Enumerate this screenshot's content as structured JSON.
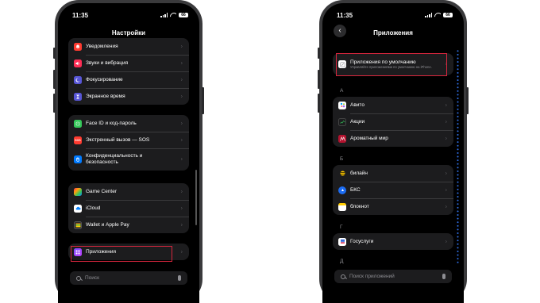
{
  "left_phone": {
    "status": {
      "time": "11:35",
      "battery": "66"
    },
    "title": "Настройки",
    "group1": [
      {
        "label": "Уведомления",
        "icon": "bell-icon",
        "color": "#ff3b30"
      },
      {
        "label": "Звуки и вибрация",
        "icon": "speaker-icon",
        "color": "#ff2d55"
      },
      {
        "label": "Фокусирование",
        "icon": "moon-icon",
        "color": "#5856d6"
      },
      {
        "label": "Экранное время",
        "icon": "hourglass-icon",
        "color": "#5856d6"
      }
    ],
    "group2": [
      {
        "label": "Face ID и код-пароль",
        "icon": "face-id-icon",
        "color": "#34c759"
      },
      {
        "label": "Экстренный вызов — SOS",
        "icon": "sos-icon",
        "color": "#ff3b30",
        "glyph": "SOS"
      },
      {
        "label": "Конфиденциальность и безопасность",
        "icon": "hand-icon",
        "color": "#007aff"
      }
    ],
    "group3": [
      {
        "label": "Game Center",
        "icon": "game-center-icon",
        "color": "#ff9f0a"
      },
      {
        "label": "iCloud",
        "icon": "cloud-icon",
        "color": "#0a84ff"
      },
      {
        "label": "Wallet и Apple Pay",
        "icon": "wallet-icon",
        "color": "#2c2c2e"
      }
    ],
    "group4": [
      {
        "label": "Приложения",
        "icon": "apps-icon",
        "color": "#7d4dff"
      }
    ],
    "search_placeholder": "Поиск"
  },
  "right_phone": {
    "status": {
      "time": "11:35",
      "battery": "66"
    },
    "title": "Приложения",
    "default_apps": {
      "label": "Приложения по умолчанию",
      "sublabel": "Управляйте приложениями по умолчанию на iPhone.",
      "icon": "default-apps-icon"
    },
    "sections": [
      {
        "letter": "А",
        "apps": [
          {
            "label": "Авито",
            "icon": "avito-icon",
            "color": "#00aaff"
          },
          {
            "label": "Акции",
            "icon": "stocks-icon",
            "color": "#1c1c1e"
          },
          {
            "label": "Ароматный мир",
            "icon": "aromatny-mir-icon",
            "color": "#b3122e"
          }
        ]
      },
      {
        "letter": "Б",
        "apps": [
          {
            "label": "билайн",
            "icon": "beeline-icon",
            "color": "#1c1c1e"
          },
          {
            "label": "БКС",
            "icon": "bks-icon",
            "color": "#1c6cf2"
          },
          {
            "label": "блокнот",
            "icon": "notepad-icon",
            "color": "#ffcc00"
          }
        ]
      },
      {
        "letter": "Г",
        "apps": [
          {
            "label": "Госуслуги",
            "icon": "gosuslugi-icon",
            "color": "#ffffff"
          }
        ]
      },
      {
        "letter": "Д",
        "apps": []
      }
    ],
    "search_placeholder": "Поиск приложений"
  },
  "colors": {
    "highlight": "#d7263d",
    "background": "#000000",
    "cell": "#1c1c1e"
  }
}
